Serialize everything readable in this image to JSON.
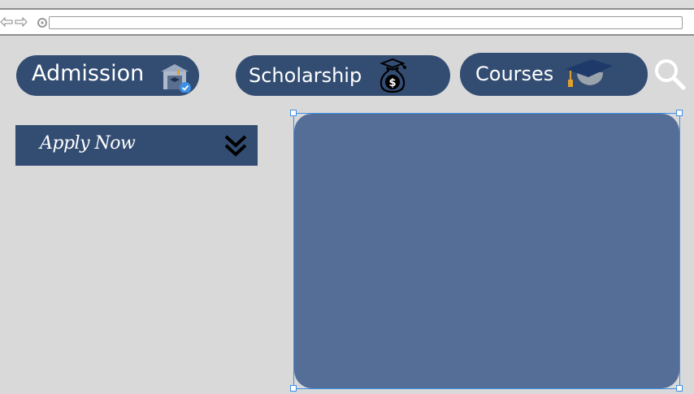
{
  "browser": {
    "url": ""
  },
  "nav": {
    "admission": {
      "label": "Admission",
      "icon": "school-building-icon"
    },
    "scholarship": {
      "label": "Scholarship",
      "icon": "money-bag-graduation-icon"
    },
    "courses": {
      "label": "Courses",
      "icon": "graduation-cap-icon"
    },
    "search_icon": "search-icon"
  },
  "sidebar": {
    "apply_label": "Apply Now",
    "toggle_icon": "double-chevron-down-icon"
  },
  "colors": {
    "pill_bg": "#334d72",
    "panel_bg": "#546e97",
    "page_bg": "#d9d9d9",
    "selection": "#3d8fe6"
  }
}
